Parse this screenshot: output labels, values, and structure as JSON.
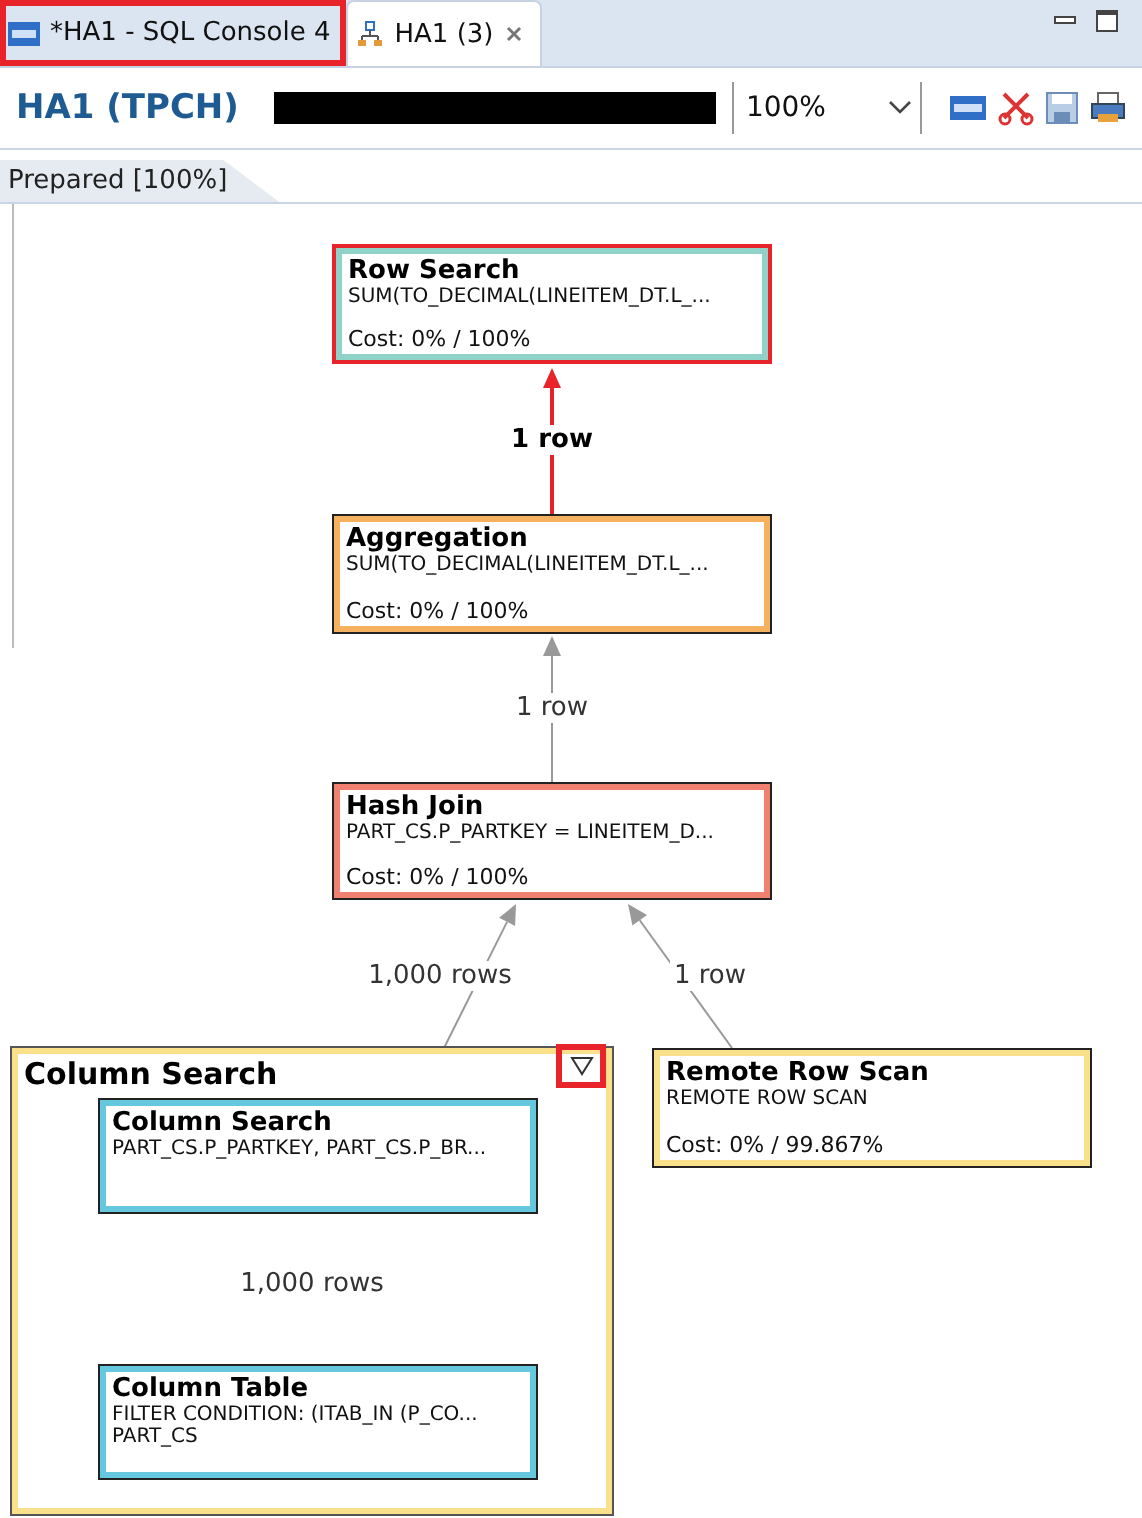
{
  "tabs": [
    {
      "label": "*HA1 - SQL Console 4",
      "selected": false,
      "highlighted": true
    },
    {
      "label": "HA1 (3)",
      "selected": true,
      "highlighted": false
    }
  ],
  "header": {
    "title": "HA1 (TPCH)",
    "zoom": "100%"
  },
  "subtab": {
    "label": "Prepared [100%]"
  },
  "plan": {
    "nodes": [
      {
        "kind": "operator",
        "title": "Row Search",
        "details": [
          "SUM(TO_DECIMAL(LINEITEM_DT.L_..."
        ],
        "cost": "Cost: 0% / 100%",
        "color": "#8fd3c8",
        "selected": true
      },
      {
        "kind": "operator",
        "title": "Aggregation",
        "details": [
          "SUM(TO_DECIMAL(LINEITEM_DT.L_..."
        ],
        "cost": "Cost: 0% / 100%",
        "color": "#f5b060",
        "selected": false
      },
      {
        "kind": "operator",
        "title": "Hash Join",
        "details": [
          "PART_CS.P_PARTKEY = LINEITEM_D..."
        ],
        "cost": "Cost: 0% / 100%",
        "color": "#f08070",
        "selected": false
      },
      {
        "kind": "group",
        "title": "Column Search",
        "color": "#fbe08c",
        "collapse_highlighted": true,
        "children": [
          {
            "kind": "operator",
            "title": "Column Search",
            "details": [
              "PART_CS.P_PARTKEY, PART_CS.P_BR..."
            ],
            "color": "#66c8de",
            "selected": false
          },
          {
            "kind": "operator",
            "title": "Column Table",
            "details": [
              "FILTER CONDITION: (ITAB_IN (P_CO...",
              "PART_CS"
            ],
            "color": "#66c8de",
            "selected": false
          }
        ]
      },
      {
        "kind": "operator",
        "title": "Remote Row Scan",
        "details": [
          "REMOTE ROW SCAN"
        ],
        "cost": "Cost: 0% / 99.867%",
        "color": "#fbe08c",
        "selected": false
      }
    ],
    "edges": [
      {
        "label": "1 row",
        "emphasized": true
      },
      {
        "label": "1 row",
        "emphasized": false
      },
      {
        "label": "1,000 rows",
        "emphasized": false
      },
      {
        "label": "1 row",
        "emphasized": false
      },
      {
        "label": "1,000 rows",
        "emphasized": false
      }
    ]
  }
}
